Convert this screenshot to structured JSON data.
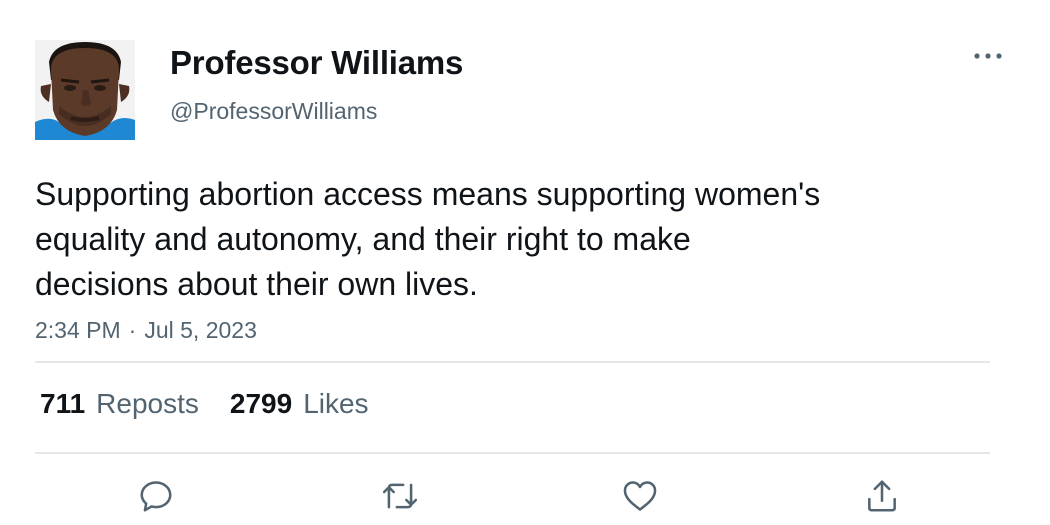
{
  "author": {
    "display_name": "Professor Williams",
    "handle": "@ProfessorWilliams"
  },
  "tweet": {
    "text": "Supporting abortion access means supporting women's\nequality and autonomy, and their right to make\ndecisions about their own lives.",
    "time": "2:34 PM",
    "separator": "·",
    "date": "Jul 5, 2023"
  },
  "stats": {
    "reposts_count": "711",
    "reposts_label": "Reposts",
    "likes_count": "2799",
    "likes_label": "Likes"
  },
  "icons": {
    "more": "more-horizontal-icon",
    "reply": "reply-icon",
    "repost": "repost-icon",
    "like": "heart-icon",
    "share": "share-icon"
  },
  "colors": {
    "text_primary": "#0f1419",
    "text_secondary": "#536471",
    "icon": "#536471",
    "divider": "#e3e7ea"
  }
}
